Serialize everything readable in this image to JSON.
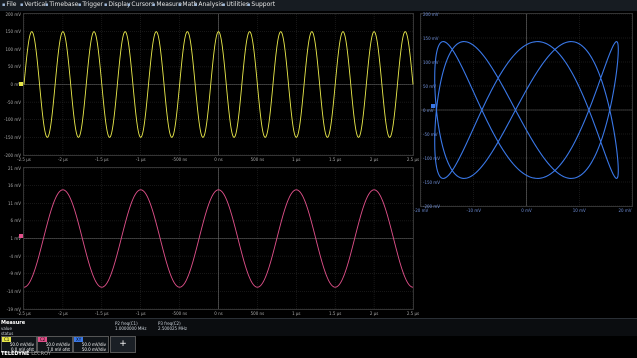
{
  "menu": {
    "items": [
      {
        "label": "File",
        "icon": "file-icon"
      },
      {
        "label": "Vertical",
        "icon": "vertical-icon"
      },
      {
        "label": "Timebase",
        "icon": "timebase-icon"
      },
      {
        "label": "Trigger",
        "icon": "trigger-icon"
      },
      {
        "label": "Display",
        "icon": "display-icon"
      },
      {
        "label": "Cursors",
        "icon": "cursors-icon"
      },
      {
        "label": "Measure",
        "icon": "measure-icon"
      },
      {
        "label": "Math",
        "icon": "math-icon"
      },
      {
        "label": "Analysis",
        "icon": "analysis-icon"
      },
      {
        "label": "Utilities",
        "icon": "utilities-icon"
      },
      {
        "label": "Support",
        "icon": "support-icon"
      }
    ]
  },
  "colors": {
    "c1": "#e8e84a",
    "c2": "#e0508a",
    "xy": "#3a78e8",
    "bg": "#000000",
    "grid": "#3a3a3a",
    "menu": "#171c22"
  },
  "chart_data": [
    {
      "type": "line",
      "title": "",
      "series": [
        {
          "channel": "C1",
          "waveform": "sine",
          "frequency_mhz": 2.5,
          "amplitude_mv": 150,
          "offset_mv": 0
        }
      ],
      "xlim": [
        -2.5,
        2.5
      ],
      "ylim": [
        -200,
        200
      ],
      "x_ticks": [
        "-2.5 µs",
        "-2 µs",
        "-1.5 µs",
        "-1 µs",
        "-500 ns",
        "0 ns",
        "500 ns",
        "1 µs",
        "1.5 µs",
        "2 µs",
        "2.5 µs"
      ],
      "y_ticks": [
        "200 mV",
        "150 mV",
        "100 mV",
        "50 mV",
        "0 mV",
        "-50 mV",
        "-100 mV",
        "-150 mV",
        "-200 mV"
      ],
      "grid": true
    },
    {
      "type": "line",
      "title": "",
      "series": [
        {
          "channel": "C2",
          "waveform": "sine",
          "frequency_mhz": 1.0,
          "amplitude_mv": 14.5,
          "offset_mv": 0
        }
      ],
      "xlim": [
        -2.5,
        2.5
      ],
      "ylim": [
        -21,
        21
      ],
      "x_ticks": [
        "-2.5 µs",
        "-2 µs",
        "-1.5 µs",
        "-1 µs",
        "-500 ns",
        "0 ns",
        "500 ns",
        "1 µs",
        "1.5 µs",
        "2 µs",
        "2.5 µs"
      ],
      "y_ticks": [
        "21 mV",
        "16 mV",
        "11 mV",
        "6 mV",
        "1 mV",
        "-4 mV",
        "-9 mV",
        "-14 mV",
        "-19 mV"
      ],
      "grid": true
    },
    {
      "type": "scatter",
      "title": "",
      "series": [
        {
          "name": "XY",
          "x_source": "C2",
          "y_source": "C1",
          "freq_ratio": "1:2.5"
        }
      ],
      "xlim": [
        -20,
        20
      ],
      "ylim": [
        -200,
        200
      ],
      "x_ticks": [
        "-20 mV",
        "-10 mV",
        "0 mV",
        "10 mV",
        "20 mV"
      ],
      "y_ticks": [
        "200 mV",
        "150 mV",
        "100 mV",
        "50 mV",
        "0 mV",
        "-50 mV",
        "-100 mV",
        "-150 mV",
        "-200 mV"
      ],
      "grid": true
    }
  ],
  "measure": {
    "title": "Measure",
    "rows": [
      "value",
      "status"
    ],
    "params": [
      {
        "label": "P2 freq(C1)",
        "value": "1.0000000 MHz"
      },
      {
        "label": "P3 freq(C2)",
        "value": "2.500025 MHz"
      }
    ]
  },
  "channels": [
    {
      "tag": "C1",
      "line1": "50.0 mV/div",
      "line2": "0.0 mV ofst",
      "color": "#e8e84a"
    },
    {
      "tag": "C2",
      "line1": "50.0 mV/div",
      "line2": "7.0 mV ofst",
      "color": "#e0508a"
    },
    {
      "tag": "XY",
      "line1": "50.0 mV/div",
      "line2": "50.0 mV/div",
      "color": "#3a78e8"
    }
  ],
  "add_button": "+",
  "brand": {
    "name": "TELEDYNE",
    "sub": "LECROY"
  }
}
